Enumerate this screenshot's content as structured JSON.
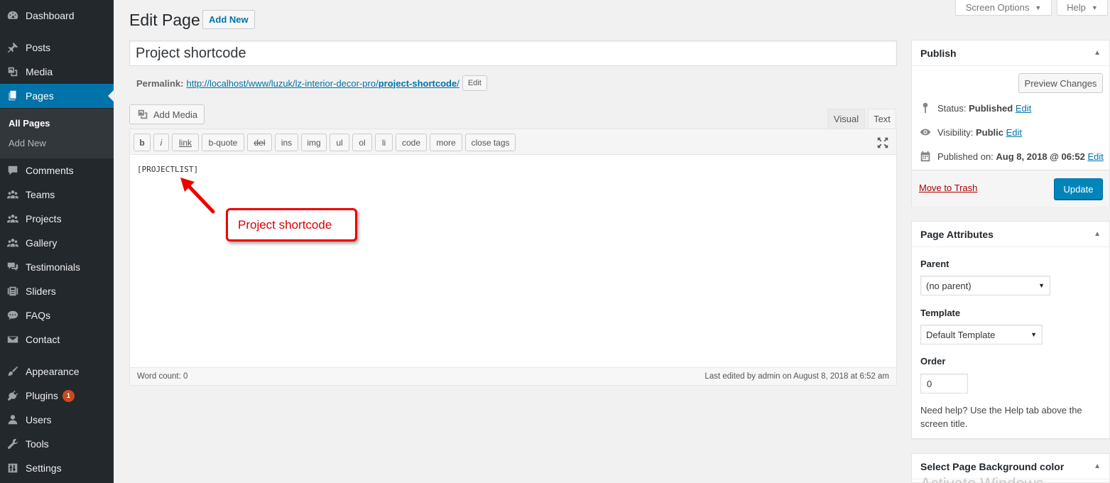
{
  "sidebar": {
    "items": [
      {
        "label": "Dashboard",
        "icon": "dashboard-icon"
      },
      {
        "label": "Posts",
        "icon": "pin-icon"
      },
      {
        "label": "Media",
        "icon": "media-icon"
      },
      {
        "label": "Pages",
        "icon": "pages-icon"
      },
      {
        "label": "Comments",
        "icon": "comment-icon"
      },
      {
        "label": "Teams",
        "icon": "groups-icon"
      },
      {
        "label": "Projects",
        "icon": "groups-icon"
      },
      {
        "label": "Gallery",
        "icon": "groups-icon"
      },
      {
        "label": "Testimonials",
        "icon": "testimonial-icon"
      },
      {
        "label": "Sliders",
        "icon": "slides-icon"
      },
      {
        "label": "FAQs",
        "icon": "chat-icon"
      },
      {
        "label": "Contact",
        "icon": "email-icon"
      },
      {
        "label": "Appearance",
        "icon": "brush-icon"
      },
      {
        "label": "Plugins",
        "icon": "plugin-icon",
        "badge": "1"
      },
      {
        "label": "Users",
        "icon": "user-icon"
      },
      {
        "label": "Tools",
        "icon": "wrench-icon"
      },
      {
        "label": "Settings",
        "icon": "settings-icon"
      }
    ],
    "submenu": [
      "All Pages",
      "Add New"
    ]
  },
  "top": {
    "screen_options": "Screen Options",
    "help": "Help"
  },
  "header": {
    "title": "Edit Page",
    "add_new": "Add New"
  },
  "post": {
    "title": "Project shortcode",
    "permalink_label": "Permalink:",
    "permalink_base": "http://localhost/www/luzuk/lz-interior-decor-pro/",
    "permalink_slug": "project-shortcode",
    "permalink_trail": "/",
    "permalink_edit": "Edit"
  },
  "editor": {
    "add_media": "Add Media",
    "tabs": [
      "Visual",
      "Text"
    ],
    "buttons": [
      "b",
      "i",
      "link",
      "b-quote",
      "del",
      "ins",
      "img",
      "ul",
      "ol",
      "li",
      "code",
      "more",
      "close tags"
    ],
    "content": "[PROJECTLIST]",
    "word_count": "Word count: 0",
    "last_edited": "Last edited by admin on August 8, 2018 at 6:52 am"
  },
  "annotation": {
    "text": "Project shortcode",
    "color": "#e00000"
  },
  "publish": {
    "title": "Publish",
    "preview": "Preview Changes",
    "status_label": "Status:",
    "status_value": "Published",
    "visibility_label": "Visibility:",
    "visibility_value": "Public",
    "published_label": "Published on:",
    "published_value": "Aug 8, 2018 @ 06:52",
    "edit": "Edit",
    "trash": "Move to Trash",
    "update": "Update"
  },
  "attributes": {
    "title": "Page Attributes",
    "parent_label": "Parent",
    "parent_value": "(no parent)",
    "template_label": "Template",
    "template_value": "Default Template",
    "order_label": "Order",
    "order_value": "0",
    "help": "Need help? Use the Help tab above the screen title."
  },
  "bgcolor": {
    "title": "Select Page Background color"
  },
  "watermark": "Activate Windows",
  "colors": {
    "sidebar": "#23282d",
    "accent": "#0073aa",
    "primary_button": "#0085ba",
    "badge": "#ca4a1f"
  }
}
